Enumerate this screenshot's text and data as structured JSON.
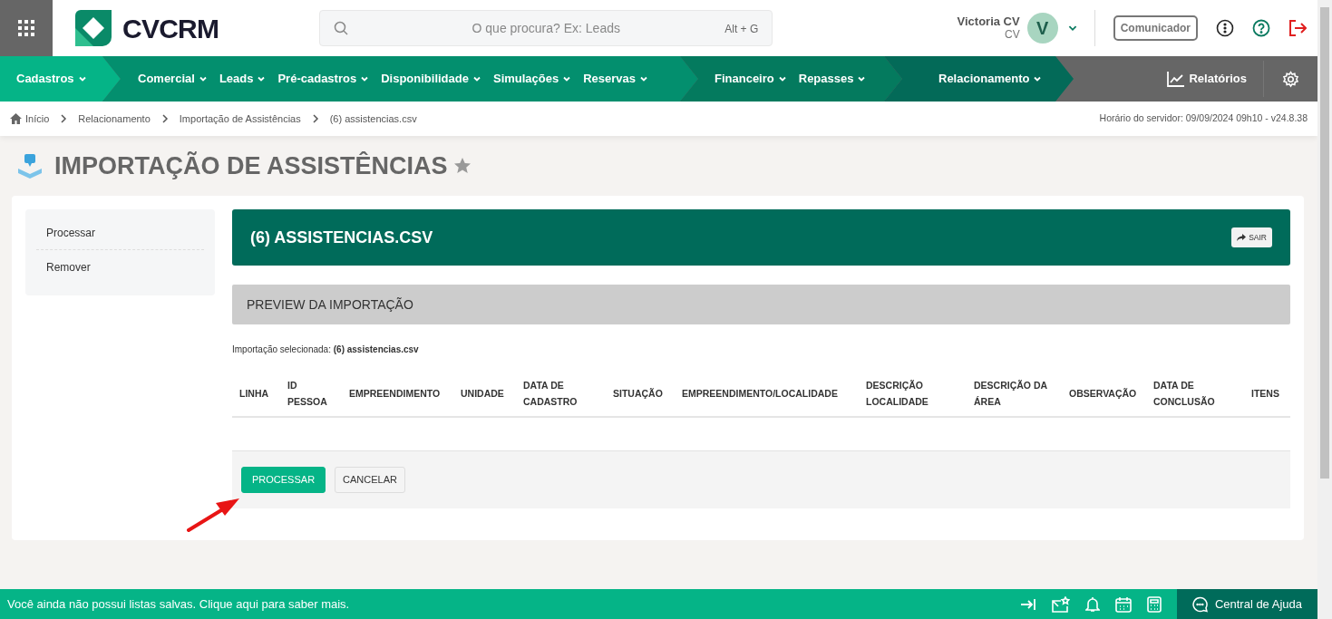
{
  "header": {
    "logo_text": "CVCRM",
    "search": {
      "placeholder": "O que procura? Ex: Leads",
      "shortcut": "Alt + G"
    },
    "user": {
      "name": "Victoria CV",
      "role": "CV",
      "avatar_letter": "V"
    },
    "communicator_button": "Comunicador"
  },
  "nav": {
    "groups": [
      {
        "items": [
          "Cadastros"
        ]
      },
      {
        "items": [
          "Comercial",
          "Leads",
          "Pré-cadastros",
          "Disponibilidade",
          "Simulações",
          "Reservas"
        ]
      },
      {
        "items": [
          "Financeiro",
          "Repasses"
        ]
      },
      {
        "items": [
          "Relacionamento"
        ]
      }
    ],
    "reports": "Relatórios"
  },
  "breadcrumb": [
    "Início",
    "Relacionamento",
    "Importação de Assistências",
    "(6) assistencias.csv"
  ],
  "server_time": "Horário do servidor: 09/09/2024 09h10 - v24.8.38",
  "page_title": "IMPORTAÇÃO DE ASSISTÊNCIAS",
  "side_menu": [
    "Processar",
    "Remover"
  ],
  "panel": {
    "title": "(6) ASSISTENCIAS.CSV",
    "exit_button": "SAIR",
    "preview_title": "PREVIEW DA IMPORTAÇÃO",
    "selected_import": "Importação selecionada: **(6) assistencias.csv**",
    "table": {
      "columns": [
        "LINHA",
        "ID PESSOA",
        "EMPREENDIMENTO",
        "UNIDADE",
        "DATA DE CADASTRO",
        "SITUAÇÃO",
        "EMPREENDIMENTO/LOCALIDADE",
        "DESCRIÇÃO LOCALIDADE",
        "DESCRIÇÃO DA ÁREA",
        "OBSERVAÇÃO",
        "DATA DE CONCLUSÃO",
        "ITENS"
      ]
    },
    "buttons": [
      "PROCESSAR",
      "CANCELAR"
    ]
  },
  "status_bar": {
    "message": "Você ainda não possui listas salvas. Clique aqui para saber mais.",
    "help": "Central de Ajuda"
  }
}
